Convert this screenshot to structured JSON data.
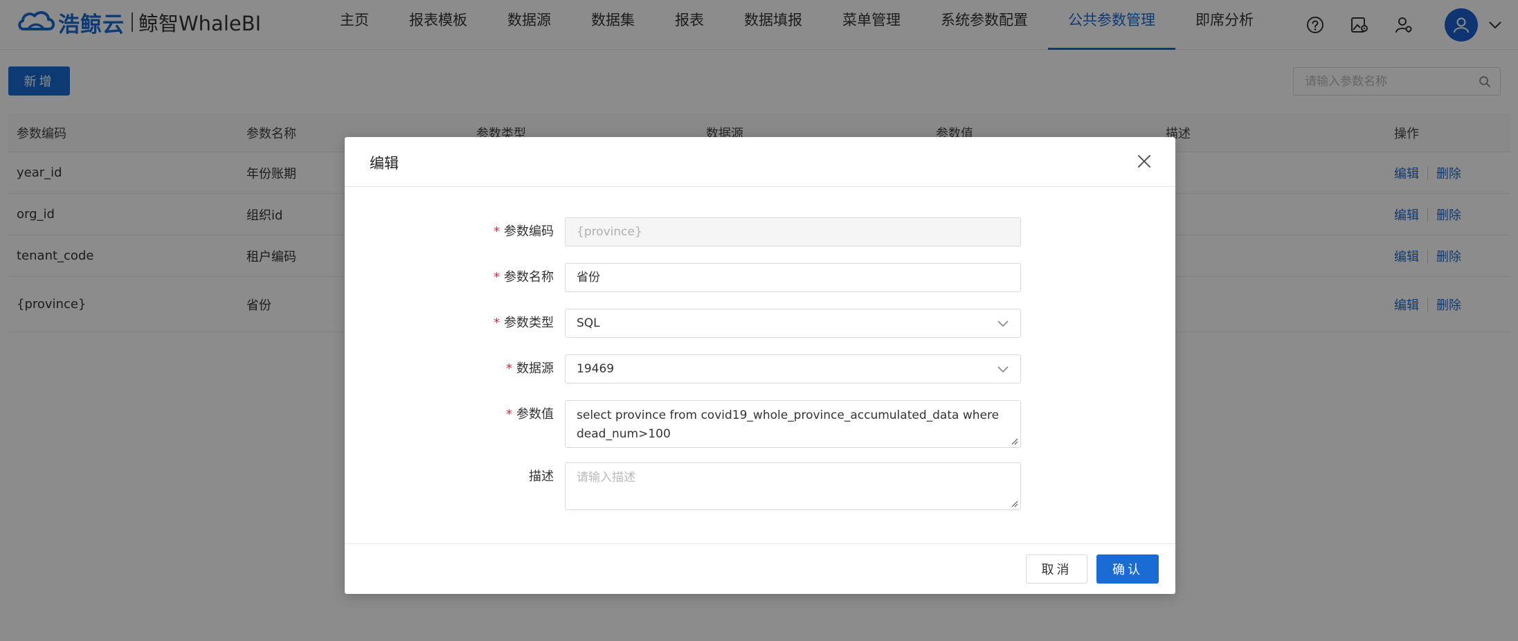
{
  "brand": {
    "company": "浩鲸云",
    "product": "鲸智WhaleBI"
  },
  "nav": [
    {
      "label": "主页"
    },
    {
      "label": "报表模板"
    },
    {
      "label": "数据源"
    },
    {
      "label": "数据集"
    },
    {
      "label": "报表"
    },
    {
      "label": "数据填报"
    },
    {
      "label": "菜单管理"
    },
    {
      "label": "系统参数配置"
    },
    {
      "label": "公共参数管理",
      "active": true
    },
    {
      "label": "即席分析"
    }
  ],
  "header_icons": [
    "help-icon",
    "image-settings-icon",
    "user-settings-icon",
    "avatar-icon",
    "chevron-down-icon"
  ],
  "toolbar": {
    "add_label": "新增",
    "search_placeholder": "请输入参数名称"
  },
  "table": {
    "columns": [
      "参数编码",
      "参数名称",
      "参数类型",
      "数据源",
      "参数值",
      "描述",
      "操作"
    ],
    "rows": [
      {
        "code": "year_id",
        "name": "年份账期"
      },
      {
        "code": "org_id",
        "name": "组织id"
      },
      {
        "code": "tenant_code",
        "name": "租户编码"
      },
      {
        "code": "{province}",
        "name": "省份"
      }
    ],
    "edit_label": "编辑",
    "delete_label": "删除"
  },
  "modal": {
    "title": "编辑",
    "fields": {
      "code": {
        "label": "参数编码",
        "value": "{province}",
        "required": true
      },
      "name": {
        "label": "参数名称",
        "value": "省份",
        "required": true
      },
      "type": {
        "label": "参数类型",
        "value": "SQL",
        "required": true
      },
      "datasource": {
        "label": "数据源",
        "value": "19469",
        "required": true
      },
      "value": {
        "label": "参数值",
        "value": "select province from covid19_whole_province_accumulated_data where dead_num>100",
        "required": true
      },
      "desc": {
        "label": "描述",
        "placeholder": "请输入描述",
        "required": false
      }
    },
    "cancel_label": "取消",
    "ok_label": "确认"
  },
  "colors": {
    "primary": "#1a6bd4",
    "required": "#f5222d",
    "mask": "rgba(0,0,0,0.45)"
  }
}
